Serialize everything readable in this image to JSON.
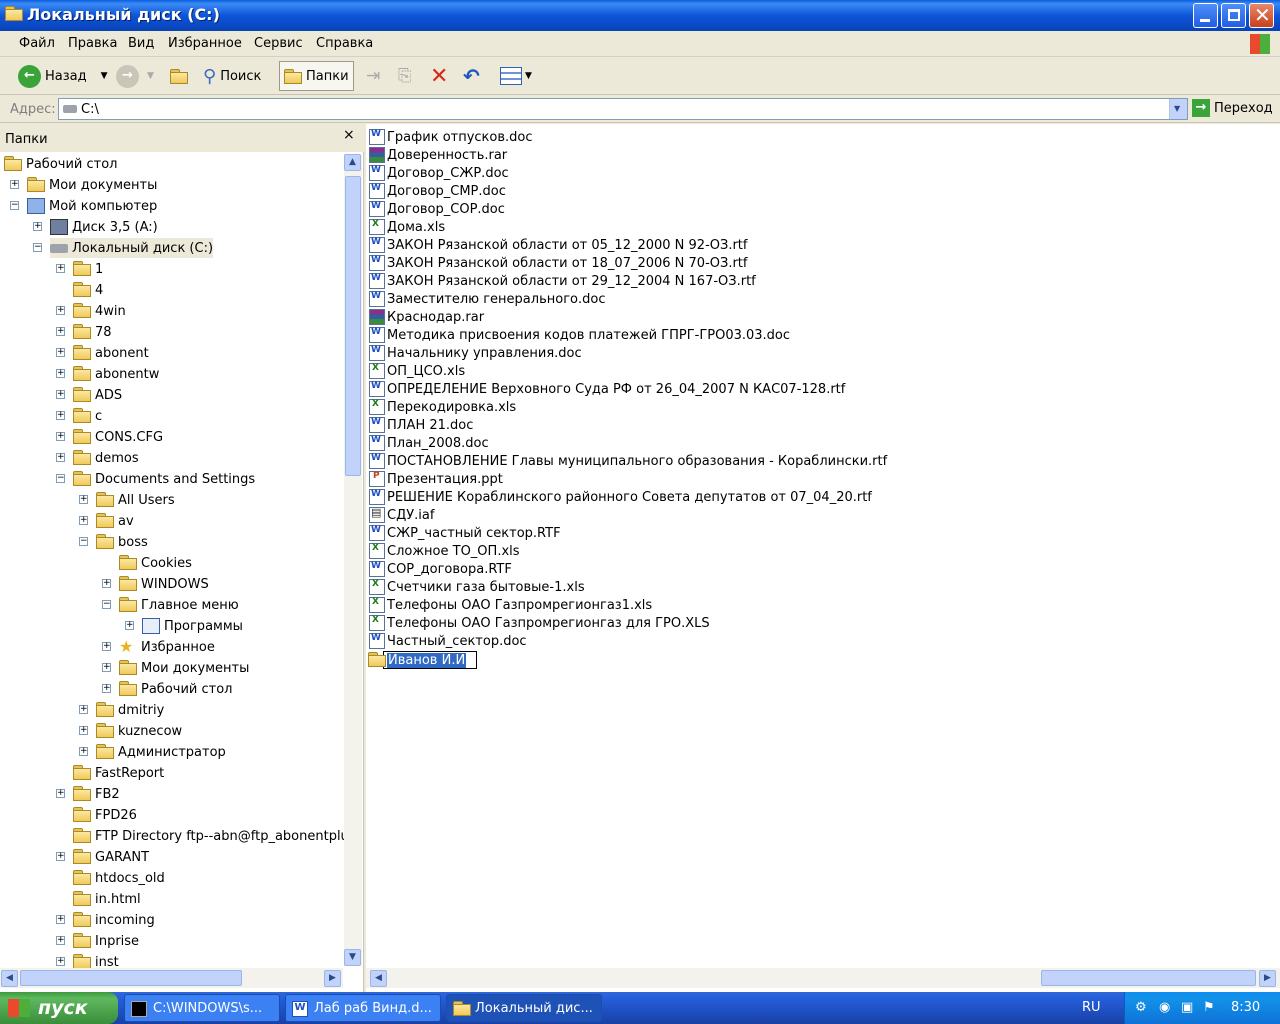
{
  "window": {
    "title": "Локальный диск (C:)"
  },
  "menu": [
    "Файл",
    "Правка",
    "Вид",
    "Избранное",
    "Сервис",
    "Справка"
  ],
  "toolbar": {
    "back": "Назад",
    "search": "Поиск",
    "folders": "Папки"
  },
  "address": {
    "label": "Адрес:",
    "value": "C:\\",
    "go": "Переход"
  },
  "tree": {
    "header": "Папки",
    "close": "×",
    "items": [
      {
        "label": "Рабочий стол"
      },
      {
        "label": "Мои документы"
      },
      {
        "label": "Мой компьютер"
      },
      {
        "label": "Диск 3,5 (A:)"
      },
      {
        "label": "Локальный диск (C:)"
      },
      {
        "label": "1"
      },
      {
        "label": "4"
      },
      {
        "label": "4win"
      },
      {
        "label": "78"
      },
      {
        "label": "abonent"
      },
      {
        "label": "abonentw"
      },
      {
        "label": "ADS"
      },
      {
        "label": "c"
      },
      {
        "label": "CONS.CFG"
      },
      {
        "label": "demos"
      },
      {
        "label": "Documents and Settings"
      },
      {
        "label": "All Users"
      },
      {
        "label": "av"
      },
      {
        "label": "boss"
      },
      {
        "label": "Cookies"
      },
      {
        "label": "WINDOWS"
      },
      {
        "label": "Главное меню"
      },
      {
        "label": "Программы"
      },
      {
        "label": "Избранное"
      },
      {
        "label": "Мои документы"
      },
      {
        "label": "Рабочий стол"
      },
      {
        "label": "dmitriy"
      },
      {
        "label": "kuznecow"
      },
      {
        "label": "Администратор"
      },
      {
        "label": "FastReport"
      },
      {
        "label": "FB2"
      },
      {
        "label": "FPD26"
      },
      {
        "label": "FTP Directory ftp--abn@ftp_abonentplus"
      },
      {
        "label": "GARANT"
      },
      {
        "label": "htdocs_old"
      },
      {
        "label": "in.html"
      },
      {
        "label": "incoming"
      },
      {
        "label": "Inprise"
      },
      {
        "label": "inst"
      }
    ]
  },
  "files": [
    {
      "name": "График отпусков.doc",
      "type": "doc"
    },
    {
      "name": "Доверенность.rar",
      "type": "rar"
    },
    {
      "name": "Договор_СЖР.doc",
      "type": "doc"
    },
    {
      "name": "Договор_СМР.doc",
      "type": "doc"
    },
    {
      "name": "Договор_СОР.doc",
      "type": "doc"
    },
    {
      "name": "Дома.xls",
      "type": "xls"
    },
    {
      "name": "ЗАКОН Рязанской области от 05_12_2000 N 92-ОЗ.rtf",
      "type": "rtf"
    },
    {
      "name": "ЗАКОН Рязанской области от 18_07_2006 N 70-ОЗ.rtf",
      "type": "rtf"
    },
    {
      "name": "ЗАКОН Рязанской области от 29_12_2004 N 167-ОЗ.rtf",
      "type": "rtf"
    },
    {
      "name": "Заместителю генерального.doc",
      "type": "doc"
    },
    {
      "name": "Краснодар.rar",
      "type": "rar"
    },
    {
      "name": "Методика присвоения кодов платежей ГПРГ-ГРО03.03.doc",
      "type": "doc"
    },
    {
      "name": "Начальнику управления.doc",
      "type": "doc"
    },
    {
      "name": "ОП_ЦСО.xls",
      "type": "xls"
    },
    {
      "name": "ОПРЕДЕЛЕНИЕ Верховного Суда РФ от 26_04_2007 N КАС07-128.rtf",
      "type": "rtf"
    },
    {
      "name": "Перекодировка.xls",
      "type": "xls"
    },
    {
      "name": "ПЛАН 21.doc",
      "type": "doc"
    },
    {
      "name": "План_2008.doc",
      "type": "doc"
    },
    {
      "name": "ПОСТАНОВЛЕНИЕ Главы муниципального образования - Кораблински.rtf",
      "type": "rtf"
    },
    {
      "name": "Презентация.ppt",
      "type": "ppt"
    },
    {
      "name": "РЕШЕНИЕ Кораблинского районного Совета депутатов от 07_04_20.rtf",
      "type": "rtf"
    },
    {
      "name": "СДУ.iaf",
      "type": "iaf"
    },
    {
      "name": "СЖР_частный сектор.RTF",
      "type": "rtf"
    },
    {
      "name": "Сложное ТО_ОП.xls",
      "type": "xls"
    },
    {
      "name": "СОР_договора.RTF",
      "type": "rtf"
    },
    {
      "name": "Счетчики газа бытовые-1.xls",
      "type": "xls"
    },
    {
      "name": "Телефоны ОАО Газпромрегионгаз1.xls",
      "type": "xls"
    },
    {
      "name": "Телефоны ОАО Газпромрегионгаз для ГРО.XLS",
      "type": "xls"
    },
    {
      "name": "Частный_сектор.doc",
      "type": "doc"
    }
  ],
  "rename": {
    "value": "Иванов И.И"
  },
  "taskbar": {
    "start": "пуск",
    "tasks": [
      "C:\\WINDOWS\\s...",
      "Лаб раб Винд.d...",
      "Локальный дис..."
    ],
    "lang": "RU",
    "clock": "8:30"
  }
}
